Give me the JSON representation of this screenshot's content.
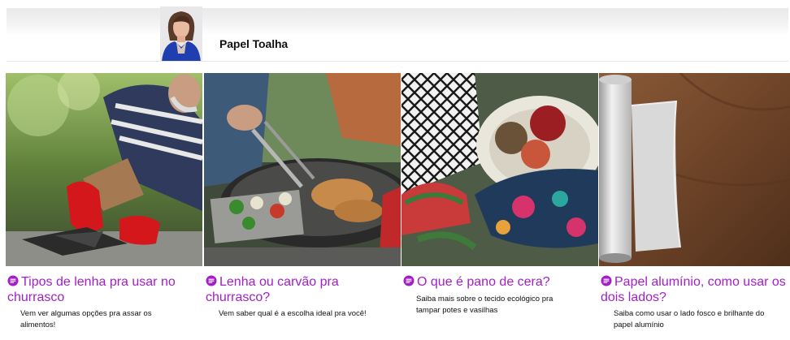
{
  "header": {
    "title": "Papel Toalha"
  },
  "colors": {
    "accent": "#a21fc7",
    "text": "#111111",
    "divider": "#e6e6e6"
  },
  "cards": [
    {
      "title": "Tipos de lenha pra usar no churrasco",
      "description": "Vem ver algumas opções pra assar os alimentos!",
      "icon": "comment-bubble-icon"
    },
    {
      "title": "Lenha ou carvão pra churrasco?",
      "description": "Vem saber qual é a escolha ideal pra você!",
      "icon": "comment-bubble-icon"
    },
    {
      "title": "O que é pano de cera?",
      "description": "Saiba mais sobre o tecido ecológico pra tampar potes e vasilhas",
      "icon": "comment-bubble-icon"
    },
    {
      "title": "Papel alumínio, como usar os dois lados?",
      "description": "Saiba como usar o lado fosco e brilhante do papel alumínio",
      "icon": "comment-bubble-icon"
    }
  ]
}
